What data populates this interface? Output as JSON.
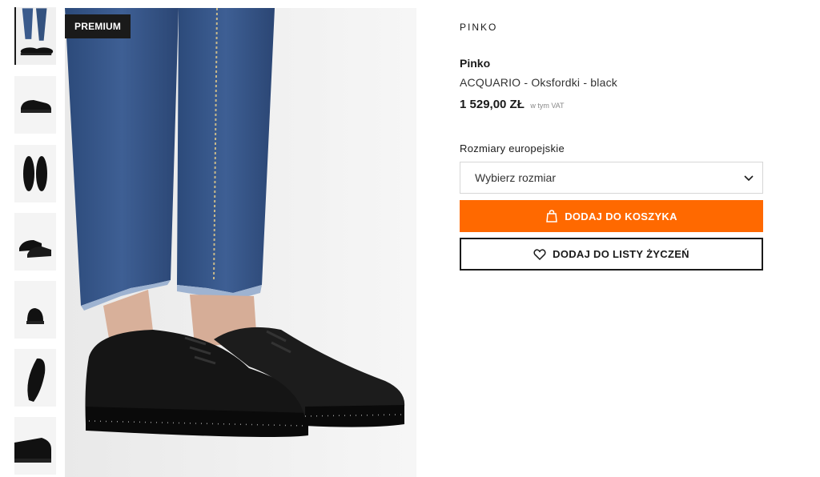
{
  "gallery": {
    "badge": "PREMIUM",
    "thumbnails": [
      {
        "alt": "legs-with-shoes"
      },
      {
        "alt": "shoe-side"
      },
      {
        "alt": "shoes-top"
      },
      {
        "alt": "shoes-pair-angle"
      },
      {
        "alt": "shoe-back"
      },
      {
        "alt": "shoe-sole"
      },
      {
        "alt": "shoe-detail"
      }
    ]
  },
  "product": {
    "brand_logo": "PINKO",
    "brand": "Pinko",
    "name": "ACQUARIO - Oksfordki - black",
    "price": "1 529,00 ZŁ",
    "vat_note": "w tym VAT"
  },
  "size": {
    "label": "Rozmiary europejskie",
    "selected": "Wybierz rozmiar"
  },
  "actions": {
    "add_to_cart": "DODAJ DO KOSZYKA",
    "add_to_wishlist": "DODAJ DO LISTY ŻYCZEŃ"
  },
  "colors": {
    "accent": "#ff6900",
    "text": "#1a1a1a",
    "badge_bg": "#1a1a1a"
  }
}
